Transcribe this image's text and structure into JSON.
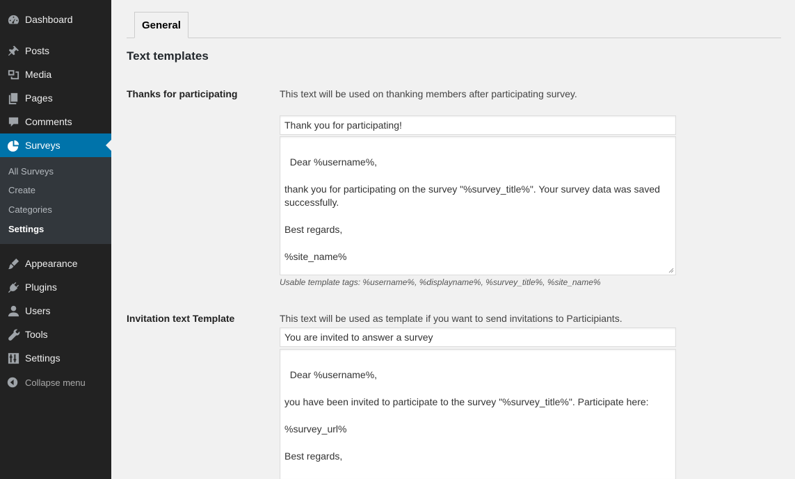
{
  "sidebar": {
    "items": [
      {
        "label": "Dashboard",
        "icon": "dashboard-icon"
      },
      {
        "label": "Posts",
        "icon": "pin-icon"
      },
      {
        "label": "Media",
        "icon": "media-icon"
      },
      {
        "label": "Pages",
        "icon": "pages-icon"
      },
      {
        "label": "Comments",
        "icon": "comment-icon"
      },
      {
        "label": "Surveys",
        "icon": "pie-chart-icon",
        "active": true
      },
      {
        "label": "Appearance",
        "icon": "brush-icon"
      },
      {
        "label": "Plugins",
        "icon": "plugin-icon"
      },
      {
        "label": "Users",
        "icon": "user-icon"
      },
      {
        "label": "Tools",
        "icon": "wrench-icon"
      },
      {
        "label": "Settings",
        "icon": "settings-icon"
      }
    ],
    "submenu": [
      "All Surveys",
      "Create",
      "Categories",
      "Settings"
    ],
    "collapse_label": "Collapse menu",
    "active_color": "#0073aa"
  },
  "main": {
    "tab_label": "General",
    "section_title": "Text templates",
    "thanks": {
      "label": "Thanks for participating",
      "description": "This text will be used on thanking members after participating survey.",
      "subject": "Thank you for participating!",
      "body": "Dear %username%,\n\nthank you for participating on the survey \"%survey_title%\". Your survey data was saved successfully.\n\nBest regards,\n\n%site_name%",
      "hint": "Usable template tags: %username%, %displayname%, %survey_title%, %site_name%"
    },
    "invitation": {
      "label": "Invitation text Template",
      "description": "This text will be used as template if you want to send invitations to Participiants.",
      "subject": "You are invited to answer a survey",
      "body": "Dear %username%,\n\nyou have been invited to participate to the survey \"%survey_title%\". Participate here:\n\n%survey_url%\n\nBest regards,\n\n%site_name%"
    }
  }
}
